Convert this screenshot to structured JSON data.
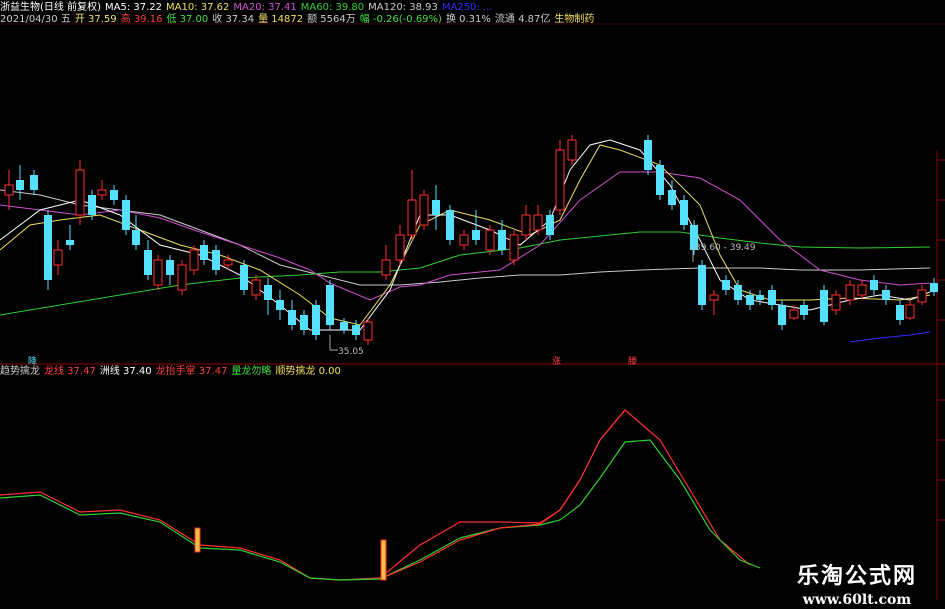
{
  "header": {
    "stock_name": "浙益生物(日线 前复权)",
    "ma_items": [
      {
        "label": "MA5: 37.22",
        "color": "#ffffff"
      },
      {
        "label": "MA10: 37.62",
        "color": "#f0e060"
      },
      {
        "label": "MA20: 37.41",
        "color": "#d050d0"
      },
      {
        "label": "MA60: 39.80",
        "color": "#30d030"
      },
      {
        "label": "MA120: 38.93",
        "color": "#cccccc"
      },
      {
        "label": "MA250: ...",
        "color": "#3030ff"
      }
    ],
    "line2": [
      {
        "label": "2021/04/30 五",
        "color": "#cccccc"
      },
      {
        "label": "开 37.59",
        "color": "#f0e060"
      },
      {
        "label": "高 39.16",
        "color": "#ff4040"
      },
      {
        "label": "低 37.00",
        "color": "#40e040"
      },
      {
        "label": "收 37.34",
        "color": "#cccccc"
      },
      {
        "label": "量 14872",
        "color": "#f0e060"
      },
      {
        "label": "额 5564万",
        "color": "#cccccc"
      },
      {
        "label": "幅 -0.26(-0.69%)",
        "color": "#40e040"
      },
      {
        "label": "换 0.31%",
        "color": "#cccccc"
      },
      {
        "label": "流通 4.87亿",
        "color": "#cccccc"
      },
      {
        "label": "生物制药",
        "color": "#f0e060"
      }
    ]
  },
  "price_panel": {
    "annotations": {
      "low_price": "35.05",
      "range": "39.60 - 39.49",
      "marker_left": "降",
      "marker_mid1": "涨",
      "marker_mid2": "滕"
    }
  },
  "indicator": {
    "header": [
      {
        "label": "趋势擒龙",
        "color": "#cccccc"
      },
      {
        "label": "龙线 37.47",
        "color": "#ff4040"
      },
      {
        "label": "洲线 37.40",
        "color": "#ffffff"
      },
      {
        "label": "龙抬手掌 37.47",
        "color": "#ff4040"
      },
      {
        "label": "量龙勿略",
        "color": "#40e040"
      },
      {
        "label": "顺势擒龙 0.00",
        "color": "#f0e060"
      }
    ]
  },
  "watermark": {
    "title": "乐淘公式网",
    "url": "www.60lt.com"
  },
  "colors": {
    "up": "#ff3030",
    "down": "#55e0ff",
    "grid": "#8b0000"
  }
}
